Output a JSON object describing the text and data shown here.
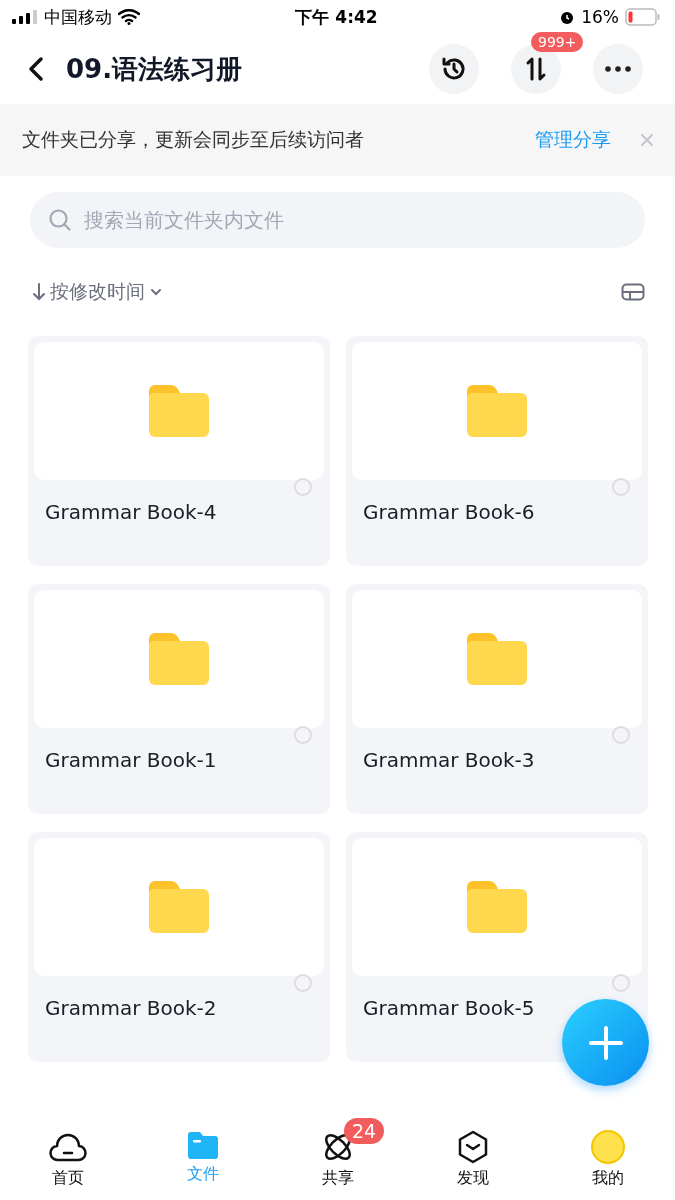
{
  "status_bar": {
    "carrier": "中国移动",
    "time": "下午 4:42",
    "battery_text": "16%"
  },
  "header": {
    "title": "09.语法练习册",
    "transfer_badge": "999+"
  },
  "banner": {
    "text": "文件夹已分享，更新会同步至后续访问者",
    "action": "管理分享"
  },
  "search": {
    "placeholder": "搜索当前文件夹内文件"
  },
  "sort": {
    "label": "按修改时间"
  },
  "files": [
    {
      "name": "Grammar Book-4",
      "checked": false
    },
    {
      "name": "Grammar Book-6",
      "checked": false
    },
    {
      "name": "Grammar Book-1",
      "checked": false
    },
    {
      "name": "Grammar Book-3",
      "checked": false
    },
    {
      "name": "Grammar Book-2",
      "checked": false
    },
    {
      "name": "Grammar Book-5",
      "checked": false
    }
  ],
  "tabs": [
    {
      "kind": "home",
      "label": "首页",
      "selected": false
    },
    {
      "kind": "files",
      "label": "文件",
      "selected": true
    },
    {
      "kind": "share",
      "label": "共享",
      "selected": false,
      "badge": "24"
    },
    {
      "kind": "discover",
      "label": "发现",
      "selected": false
    },
    {
      "kind": "me",
      "label": "我的",
      "selected": false
    }
  ]
}
